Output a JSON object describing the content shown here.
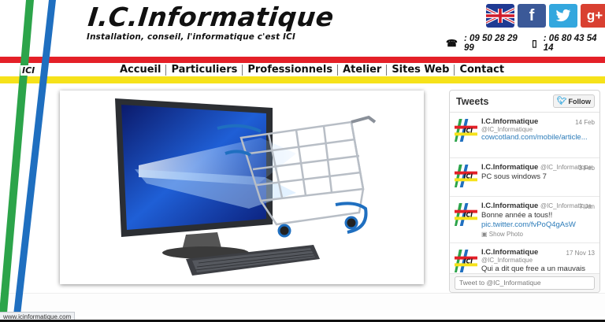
{
  "header": {
    "title": "I.C.Informatique",
    "tagline": "Installation, conseil, l'informatique c'est ICI",
    "phone_landline": ": 09 50 28 29 99",
    "phone_mobile": ": 06 80 43 54 14"
  },
  "socials": {
    "facebook_glyph": "f",
    "google_glyph": "g+"
  },
  "nav": {
    "badge": "ICI",
    "items": [
      "Accueil",
      "Particuliers",
      "Professionnels",
      "Atelier",
      "Sites Web",
      "Contact"
    ]
  },
  "twitter": {
    "title": "Tweets",
    "follow_label": "Follow",
    "tweets": [
      {
        "name": "I.C.Informatique",
        "handle": "@IC_Informatique",
        "date": "14 Feb",
        "text": "",
        "link": "cowcotland.com/mobile/article...",
        "photo": ""
      },
      {
        "name": "I.C.Informatique",
        "handle": "@IC_Informatique",
        "date": "3 Feb",
        "text": "PC sous windows 7",
        "link": "",
        "photo": ""
      },
      {
        "name": "I.C.Informatique",
        "handle": "@IC_Informatique",
        "date": "7 Jan",
        "text": "Bonne année a tous!!",
        "link": "pic.twitter.com/fvPoQ4gAsW",
        "photo": "Show Photo"
      },
      {
        "name": "I.C.Informatique",
        "handle": "@IC_Informatique",
        "date": "17 Nov 13",
        "text": "Qui a dit que free a un mauvais service client?",
        "link": "",
        "photo": ""
      }
    ],
    "compose_placeholder": "Tweet to @IC_Informatique"
  },
  "status_bar": {
    "url": "www.icinformatique.com"
  },
  "colors": {
    "red": "#e42028",
    "yellow": "#f6e21a",
    "green": "#2ca44a",
    "blue": "#1f6fc0",
    "facebook": "#3b5998",
    "twitter": "#33a7de",
    "google": "#d94031"
  }
}
